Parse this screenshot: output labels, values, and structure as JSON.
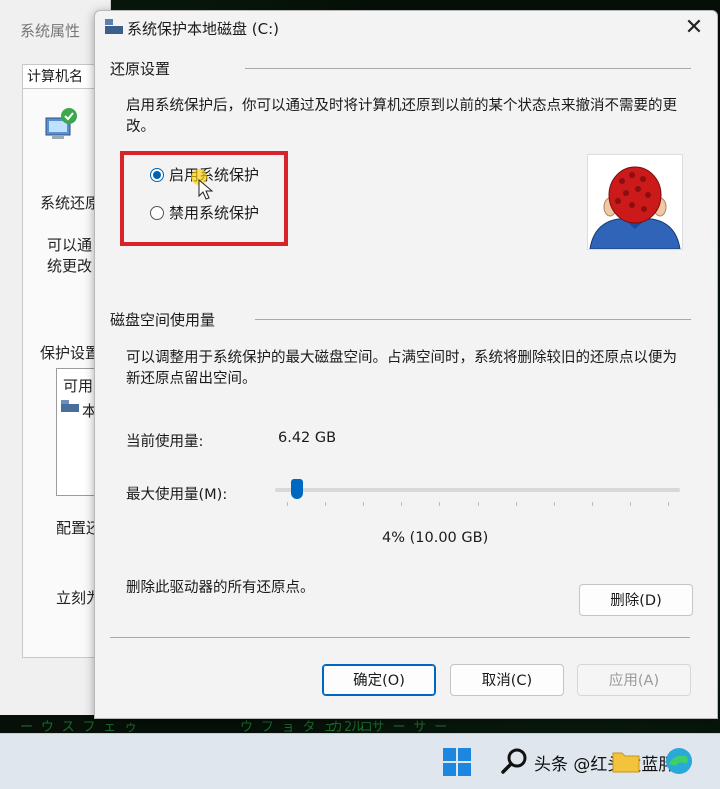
{
  "background_window": {
    "title": "系统属性",
    "tab": "计算机名",
    "text_restore": "系统还原",
    "text_can1": "可以通",
    "text_can2": "统更改",
    "text_protect": "保护设置",
    "list_header": "可用",
    "list_drive": "本",
    "text_config": "配置还",
    "text_now": "立刻为"
  },
  "dialog": {
    "title": "系统保护本地磁盘 (C:)",
    "restore_settings": {
      "heading": "还原设置",
      "description": "启用系统保护后，你可以通过及时将计算机还原到以前的某个状态点来撤消不需要的更改。",
      "options": [
        {
          "label": "启用系统保护",
          "checked": true
        },
        {
          "label": "禁用系统保护",
          "checked": false
        }
      ]
    },
    "disk_usage": {
      "heading": "磁盘空间使用量",
      "description": "可以调整用于系统保护的最大磁盘空间。占满空间时，系统将删除较旧的还原点以便为新还原点留出空间。",
      "current_label": "当前使用量:",
      "current_value": "6.42 GB",
      "max_label": "最大使用量(M):",
      "max_percent": 0.04,
      "max_value_text": "4% (10.00 GB)",
      "delete_text": "删除此驱动器的所有还原点。",
      "delete_button": "删除(D)"
    },
    "buttons": {
      "ok": "确定(O)",
      "cancel": "取消(C)",
      "apply": "应用(A)"
    }
  },
  "taskbar": {
    "watermark": "头条 @红头发蓝胖子"
  },
  "colors": {
    "accent": "#0067c0",
    "highlight_box": "#d9232a"
  }
}
